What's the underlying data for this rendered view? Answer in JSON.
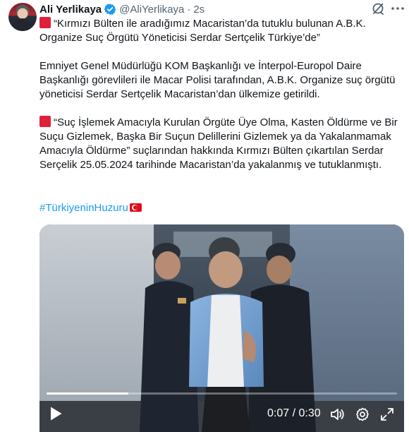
{
  "tweet": {
    "author_name": "Ali Yerlikaya",
    "handle": "@AliYerlikaya",
    "separator": "·",
    "time": "2s",
    "verified": true,
    "paragraphs": [
      "“Kırmızı Bülten ile aradığımız Macaristan’da tutuklu bulunan A.B.K. Organize Suç Örgütü Yöneticisi Serdar Sertçelik Türkiye’de”",
      "Emniyet Genel Müdürlüğü KOM Başkanlığı ve İnterpol-Europol Daire Başkanlığı görevlileri ile Macar Polisi tarafından, A.B.K. Organize suç örgütü yöneticisi Serdar Sertçelik Macaristan’dan ülkemize getirildi.",
      "“Suç İşlemek Amacıyla Kurulan Örgüte Üye Olma, Kasten Öldürme ve Bir Suçu Gizlemek, Başka Bir Suçun Delillerini Gizlemek ya da Yakalanmamak Amacıyla Öldürme” suçlarından hakkında Kırmızı Bülten çıkartılan Serdar Serçelik 25.05.2024 tarihinde Macaristan’da yakalanmış ve tutuklanmıştı."
    ],
    "hashtag": "#TürkiyeninHuzuru",
    "icons": {
      "verified": "verified-badge-icon",
      "grok": "grok-icon",
      "more": "more-icon",
      "bullet": "red-square-emoji",
      "flag": "turkey-flag-emoji"
    },
    "colors": {
      "link": "#1d9bf0",
      "verified": "#1d9bf0",
      "bullet": "#e0213a",
      "secondary_text": "#536471"
    }
  },
  "video": {
    "current_time": "0:07",
    "time_separator": "/",
    "duration": "0:30",
    "progress_fraction": 0.233,
    "icons": [
      "play-icon",
      "volume-icon",
      "settings-icon",
      "fullscreen-icon"
    ]
  }
}
